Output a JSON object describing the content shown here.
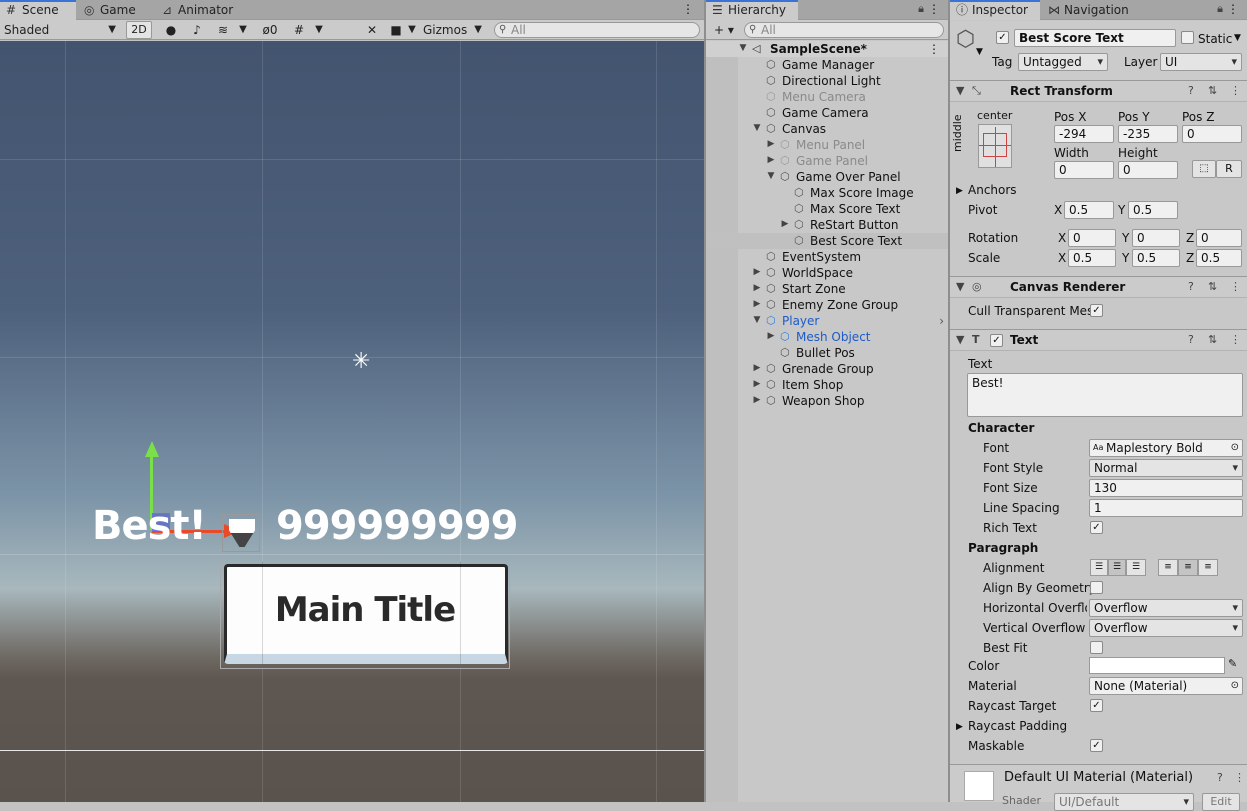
{
  "scene": {
    "tabs": [
      "Scene",
      "Game",
      "Animator"
    ],
    "shading": "Shaded",
    "mode_2d": "2D",
    "hidden_count": "0",
    "gizmos": "Gizmos",
    "search_placeholder": "All",
    "best_text": "Best!",
    "score_text": "999999999",
    "button_text": "Main Title"
  },
  "hierarchy": {
    "tab": "Hierarchy",
    "search_placeholder": "All",
    "add": "+ ▾",
    "scene_name": "SampleScene*",
    "items": [
      {
        "label": "Game Manager",
        "depth": 2,
        "arrow": "",
        "style": "normal"
      },
      {
        "label": "Directional Light",
        "depth": 2,
        "arrow": "",
        "style": "normal"
      },
      {
        "label": "Menu Camera",
        "depth": 2,
        "arrow": "",
        "style": "gray"
      },
      {
        "label": "Game Camera",
        "depth": 2,
        "arrow": "",
        "style": "normal"
      },
      {
        "label": "Canvas",
        "depth": 2,
        "arrow": "▼",
        "style": "normal"
      },
      {
        "label": "Menu Panel",
        "depth": 3,
        "arrow": "▶",
        "style": "gray"
      },
      {
        "label": "Game Panel",
        "depth": 3,
        "arrow": "▶",
        "style": "gray"
      },
      {
        "label": "Game Over Panel",
        "depth": 3,
        "arrow": "▼",
        "style": "normal"
      },
      {
        "label": "Max Score Image",
        "depth": 4,
        "arrow": "",
        "style": "normal"
      },
      {
        "label": "Max Score Text",
        "depth": 4,
        "arrow": "",
        "style": "normal"
      },
      {
        "label": "ReStart Button",
        "depth": 4,
        "arrow": "▶",
        "style": "normal"
      },
      {
        "label": "Best Score Text",
        "depth": 4,
        "arrow": "",
        "style": "selected"
      },
      {
        "label": "EventSystem",
        "depth": 2,
        "arrow": "",
        "style": "normal"
      },
      {
        "label": "WorldSpace",
        "depth": 2,
        "arrow": "▶",
        "style": "normal"
      },
      {
        "label": "Start Zone",
        "depth": 2,
        "arrow": "▶",
        "style": "normal"
      },
      {
        "label": "Enemy Zone Group",
        "depth": 2,
        "arrow": "▶",
        "style": "normal"
      },
      {
        "label": "Player",
        "depth": 2,
        "arrow": "▼",
        "style": "blue"
      },
      {
        "label": "Mesh Object",
        "depth": 3,
        "arrow": "▶",
        "style": "blue"
      },
      {
        "label": "Bullet Pos",
        "depth": 3,
        "arrow": "",
        "style": "normal"
      },
      {
        "label": "Grenade Group",
        "depth": 2,
        "arrow": "▶",
        "style": "normal"
      },
      {
        "label": "Item Shop",
        "depth": 2,
        "arrow": "▶",
        "style": "normal"
      },
      {
        "label": "Weapon Shop",
        "depth": 2,
        "arrow": "▶",
        "style": "normal"
      }
    ]
  },
  "inspector": {
    "tabs": [
      "Inspector",
      "Navigation"
    ],
    "object_name": "Best Score Text",
    "static_label": "Static",
    "tag_label": "Tag",
    "tag_value": "Untagged",
    "layer_label": "Layer",
    "layer_value": "UI",
    "rect": {
      "title": "Rect Transform",
      "anchor_h": "center",
      "anchor_v": "middle",
      "posx_label": "Pos X",
      "posx": "-294",
      "posy_label": "Pos Y",
      "posy": "-235",
      "posz_label": "Pos Z",
      "posz": "0",
      "width_label": "Width",
      "width": "0",
      "height_label": "Height",
      "height": "0",
      "r_button": "R",
      "anchors": "Anchors",
      "pivot": "Pivot",
      "pivot_x": "0.5",
      "pivot_y": "0.5",
      "rotation": "Rotation",
      "rot_x": "0",
      "rot_y": "0",
      "rot_z": "0",
      "scale": "Scale",
      "scale_x": "0.5",
      "scale_y": "0.5",
      "scale_z": "0.5",
      "x": "X",
      "y": "Y",
      "z": "Z"
    },
    "canvas_renderer": {
      "title": "Canvas Renderer",
      "cull_label": "Cull Transparent Mes"
    },
    "text": {
      "title": "Text",
      "text_label": "Text",
      "text_value": "Best!",
      "character": "Character",
      "font_label": "Font",
      "font_value": "Maplestory Bold",
      "font_style_label": "Font Style",
      "font_style_value": "Normal",
      "font_size_label": "Font Size",
      "font_size_value": "130",
      "line_spacing_label": "Line Spacing",
      "line_spacing_value": "1",
      "rich_text_label": "Rich Text",
      "paragraph": "Paragraph",
      "alignment_label": "Alignment",
      "align_geom_label": "Align By Geometry",
      "h_overflow_label": "Horizontal Overflo",
      "h_overflow_value": "Overflow",
      "v_overflow_label": "Vertical Overflow",
      "v_overflow_value": "Overflow",
      "best_fit_label": "Best Fit",
      "color_label": "Color",
      "material_label": "Material",
      "material_value": "None (Material)",
      "raycast_target_label": "Raycast Target",
      "raycast_padding_label": "Raycast Padding",
      "maskable_label": "Maskable"
    },
    "material_footer": {
      "name": "Default UI Material (Material)",
      "shader_label": "Shader",
      "shader_value": "UI/Default",
      "edit": "Edit"
    }
  },
  "colors": {
    "sky_top": "#4a5c78",
    "sky_horizon": "#9fb0b8",
    "ground": "#5e5650",
    "selection": "#c0c0c0",
    "accent": "#3a72d8"
  }
}
